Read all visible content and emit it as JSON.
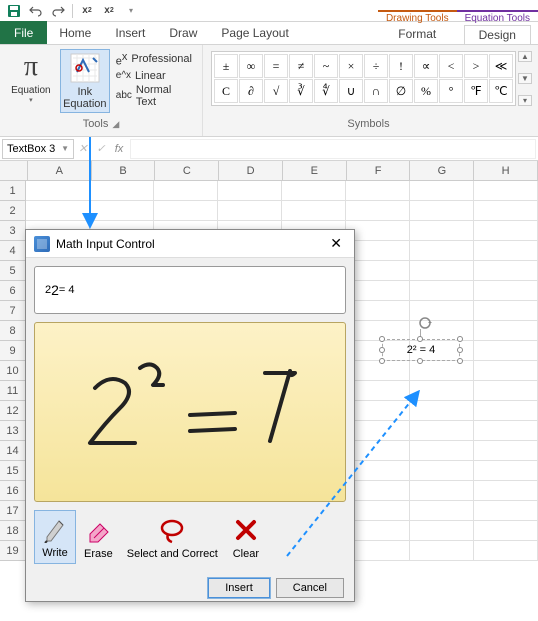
{
  "qat": {
    "save": "💾"
  },
  "tabs": {
    "file": "File",
    "home": "Home",
    "insert": "Insert",
    "draw": "Draw",
    "pagelayout": "Page Layout"
  },
  "context": {
    "drawing_tools": "Drawing Tools",
    "equation_tools": "Equation Tools",
    "format": "Format",
    "design": "Design"
  },
  "ribbon": {
    "equation": "Equation",
    "ink_equation": "Ink Equation",
    "professional": "Professional",
    "linear": "Linear",
    "normal_text": "Normal Text",
    "tools_label": "Tools",
    "symbols_label": "Symbols"
  },
  "symbols_row1": [
    "±",
    "∞",
    "=",
    "≠",
    "~",
    "×",
    "÷",
    "!",
    "∝",
    "<",
    ">",
    "≪"
  ],
  "symbols_row2": [
    "C",
    "∂",
    "√",
    "∛",
    "∜",
    "∪",
    "∩",
    "∅",
    "%",
    "°",
    "℉",
    "℃"
  ],
  "namebox": "TextBox 3",
  "cols": [
    "A",
    "B",
    "C",
    "D",
    "E",
    "F",
    "G",
    "H"
  ],
  "rows": [
    "1",
    "2",
    "3",
    "4",
    "5",
    "6",
    "7",
    "8",
    "9",
    "10",
    "11",
    "12",
    "13",
    "14",
    "15",
    "16",
    "17",
    "18",
    "19"
  ],
  "textbox_content": "2² = 4",
  "dialog": {
    "title": "Math Input Control",
    "preview_base": "2",
    "preview_sup": "2",
    "preview_rest": " = 4",
    "write": "Write",
    "erase": "Erase",
    "select_correct": "Select and Correct",
    "clear": "Clear",
    "insert": "Insert",
    "cancel": "Cancel"
  }
}
